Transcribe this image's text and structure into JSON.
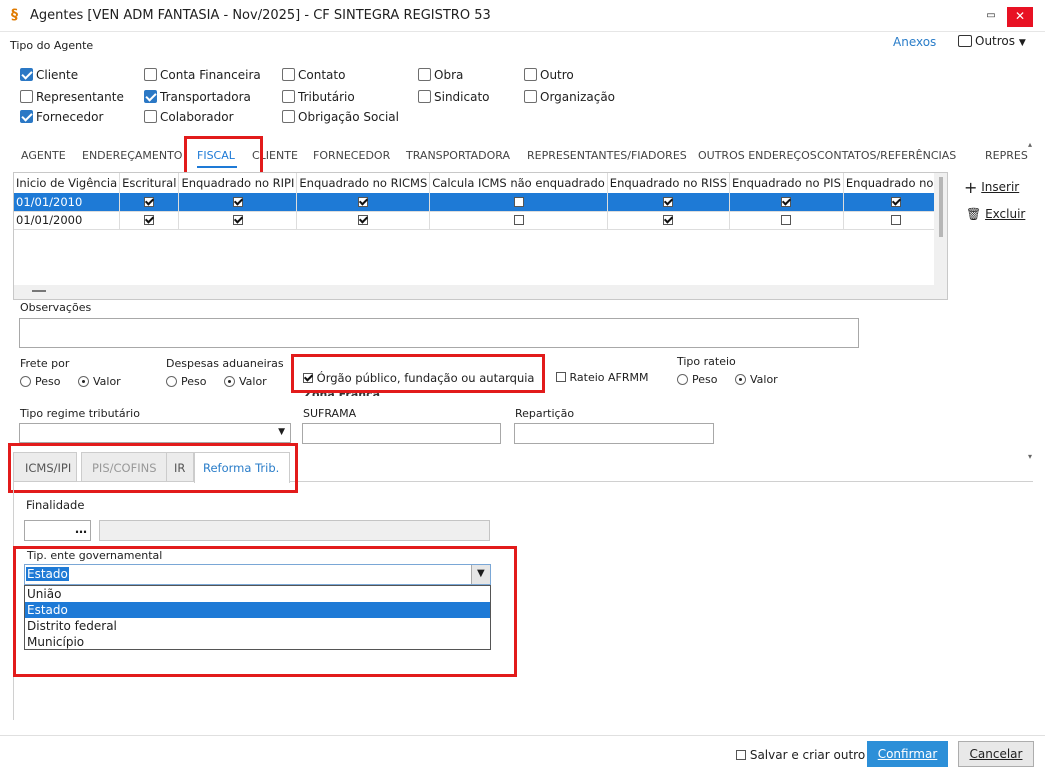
{
  "window": {
    "title": "Agentes [VEN ADM FANTASIA - Nov/2025]  - CF SINTEGRA REGISTRO 53"
  },
  "header": {
    "tipo_agente": "Tipo do Agente",
    "anexos": "Anexos",
    "outros": "Outros"
  },
  "agent_types": [
    {
      "label": "Cliente",
      "checked": true
    },
    {
      "label": "Conta Financeira",
      "checked": false
    },
    {
      "label": "Contato",
      "checked": false
    },
    {
      "label": "Obra",
      "checked": false
    },
    {
      "label": "Outro",
      "checked": false
    },
    {
      "label": "Representante",
      "checked": false
    },
    {
      "label": "Transportadora",
      "checked": true
    },
    {
      "label": "Tributário",
      "checked": false
    },
    {
      "label": "Sindicato",
      "checked": false
    },
    {
      "label": "Organização",
      "checked": false
    },
    {
      "label": "Fornecedor",
      "checked": true
    },
    {
      "label": "Colaborador",
      "checked": false
    },
    {
      "label": "Obrigação Social",
      "checked": false
    }
  ],
  "tabs": [
    "AGENTE",
    "ENDEREÇAMENTO",
    "FISCAL",
    "CLIENTE",
    "FORNECEDOR",
    "TRANSPORTADORA",
    "REPRESENTANTES/FIADORES",
    "OUTROS ENDEREÇOS",
    "CONTATOS/REFERÊNCIAS",
    "REPRES"
  ],
  "grid": {
    "columns": [
      "Inicio de Vigência",
      "Escritural",
      "Enquadrado no RIPI",
      "Enquadrado no RICMS",
      "Calcula ICMS não enquadrado",
      "Enquadrado no RISS",
      "Enquadrado no PIS",
      "Enquadrado no C"
    ],
    "rows": [
      {
        "date": "01/01/2010",
        "values": [
          true,
          true,
          true,
          false,
          true,
          true,
          true
        ]
      },
      {
        "date": "01/01/2000",
        "values": [
          true,
          true,
          true,
          false,
          true,
          false,
          false
        ]
      }
    ]
  },
  "side_actions": {
    "insert": "Inserir",
    "delete": "Excluir"
  },
  "observacoes": {
    "label": "Observações",
    "value": ""
  },
  "frete": {
    "label": "Frete por",
    "peso": "Peso",
    "valor": "Valor"
  },
  "despesas": {
    "label": "Despesas aduaneiras",
    "peso": "Peso",
    "valor": "Valor"
  },
  "orgao_publico": {
    "label": "Órgão público, fundação ou autarquia",
    "checked": true
  },
  "zona_franca": "Zona Franca",
  "rateio_afrmm": {
    "label": "Rateio AFRMM",
    "checked": false
  },
  "tipo_rateio": {
    "label": "Tipo rateio",
    "peso": "Peso",
    "valor": "Valor"
  },
  "tipo_regime": {
    "label": "Tipo regime tributário",
    "value": ""
  },
  "suframa": {
    "label": "SUFRAMA",
    "value": ""
  },
  "reparticao": {
    "label": "Repartição",
    "value": ""
  },
  "subtabs": [
    "ICMS/IPI",
    "PIS/COFINS",
    "IR",
    "Reforma Trib."
  ],
  "finalidade": {
    "label": "Finalidade",
    "browse": "…"
  },
  "tip_ente": {
    "label": "Tip. ente governamental",
    "selected": "Estado",
    "options": [
      "União",
      "Estado",
      "Distrito federal",
      "Município"
    ]
  },
  "footer": {
    "salvar_criar": "Salvar e criar outro",
    "confirmar": "Confirmar",
    "cancelar": "Cancelar"
  }
}
